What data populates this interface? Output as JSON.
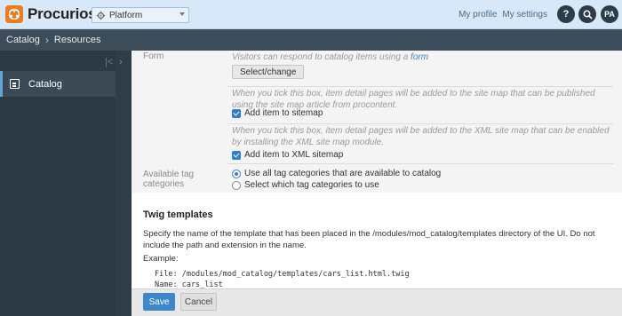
{
  "header": {
    "logo_text": "Procurios",
    "platform_select": "Platform",
    "links": [
      "My profile",
      "My settings"
    ],
    "help_label": "?",
    "avatar_initials": "PA",
    "colors": {
      "accent": "#f27a1a",
      "topbar": "#d7e9f8",
      "dark": "#2c3c49"
    }
  },
  "breadcrumb": {
    "items": [
      "Catalog",
      "Resources"
    ]
  },
  "sidebar": {
    "items": [
      {
        "label": "Catalog",
        "icon": "catalog-icon",
        "active": true
      }
    ]
  },
  "form": {
    "form_label": "Form",
    "form_help_prefix": "Visitors can respond to catalog items using a ",
    "form_help_link": "form",
    "select_change_label": "Select/change",
    "sitemap_help": "When you tick this box, item detail pages will be added to the site map that can be published using the site map article from procontent.",
    "sitemap_checkbox": "Add item to sitemap",
    "xml_help": "When you tick this box, item detail pages will be added to the XML site map that can be enabled by installing the XML site map module.",
    "xml_checkbox": "Add item to XML sitemap",
    "tag_label": "Available tag categories",
    "tag_options": [
      "Use all tag categories that are available to catalog",
      "Select which tag categories to use"
    ]
  },
  "twig": {
    "title": "Twig templates",
    "description": "Specify the name of the template that has been placed in the /modules/mod_catalog/templates directory of the UI. Do not include the path and extension in the name.",
    "example_label": "Example:",
    "example_code": "File: /modules/mod_catalog/templates/cars_list.html.twig\nName: cars_list"
  },
  "footer": {
    "save_label": "Save",
    "cancel_label": "Cancel"
  }
}
